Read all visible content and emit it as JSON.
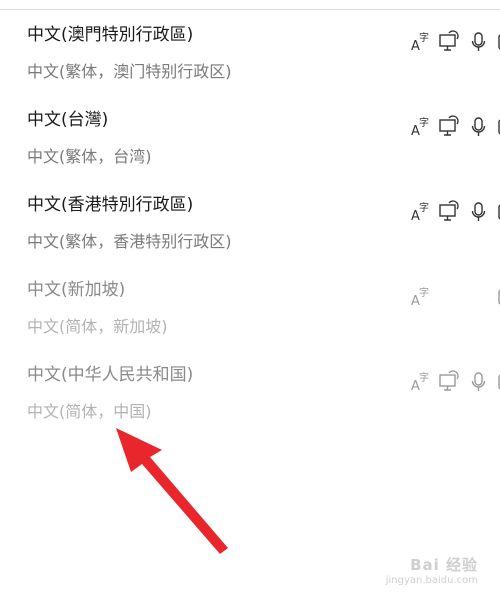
{
  "languages": [
    {
      "name": "中文(澳門特別行政區)",
      "sub": "中文(繁体，澳门特别行政区)",
      "enabled": true,
      "features": [
        "language-pack-icon",
        "display-icon",
        "",
        "partial-icon"
      ]
    },
    {
      "name": "中文(台灣)",
      "sub": "中文(繁体，台湾)",
      "enabled": true,
      "features": [
        "language-pack-icon",
        "display-icon",
        "microphone-icon",
        "partial-icon"
      ]
    },
    {
      "name": "中文(香港特別行政區)",
      "sub": "中文(繁体，香港特别行政区)",
      "enabled": true,
      "features": [
        "language-pack-icon",
        "display-icon",
        "microphone-icon",
        "partial-icon"
      ]
    },
    {
      "name": "中文(新加坡)",
      "sub": "中文(简体，新加坡)",
      "enabled": false,
      "features": [
        "language-pack-icon",
        "",
        "",
        "partial-icon"
      ]
    },
    {
      "name": "中文(中华人民共和国)",
      "sub": "中文(简体，中国)",
      "enabled": false,
      "features": [
        "language-pack-icon",
        "display-icon",
        "microphone-icon",
        "partial-icon"
      ]
    }
  ],
  "annotation": {
    "arrow_color": "#e8262b"
  },
  "watermark": {
    "logo": "Bai 经验",
    "url": "jingyan.baidu.com"
  },
  "colors": {
    "text_primary": "#1a1a1a",
    "text_secondary": "#7a7a7a",
    "text_dim": "#8a8a8a",
    "divider": "#d9d9d9"
  }
}
